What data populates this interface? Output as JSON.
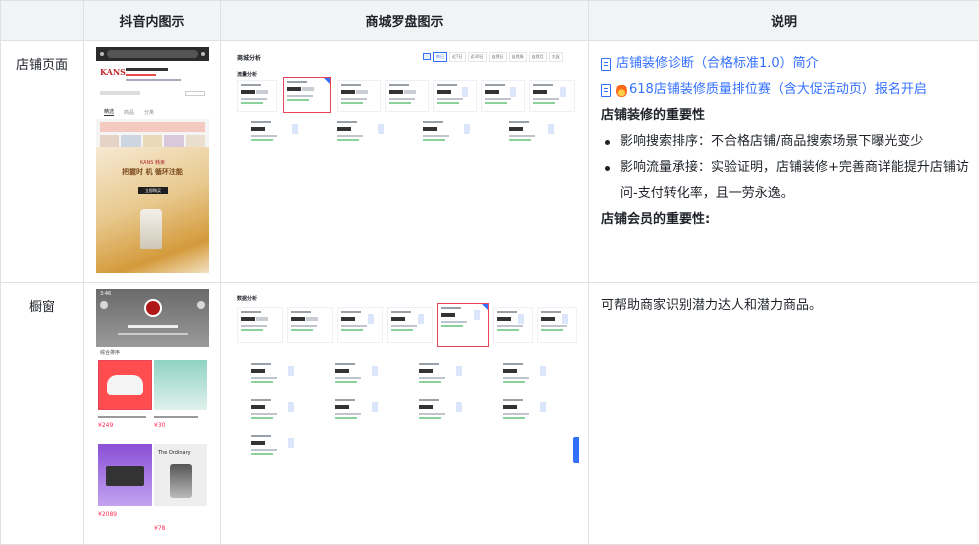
{
  "table": {
    "headers": [
      "",
      "抖音内图示",
      "商城罗盘图示",
      "说明"
    ],
    "rows": [
      {
        "label": "店铺页面",
        "links": [
          {
            "icon": "doc-icon",
            "text": "店铺装修诊断（合格标准1.0）简介"
          },
          {
            "icon": "doc-icon",
            "fire": true,
            "text": "618店铺装修质量排位赛（含大促活动页）报名开启"
          }
        ],
        "heading1": "店铺装修的重要性",
        "bullets": [
          "影响搜索排序：不合格店铺/商品搜索场景下曝光变少",
          "影响流量承接：实验证明，店铺装修+完善商详能提升店铺访问-支付转化率，且一劳永逸。"
        ],
        "heading2": "店铺会员的重要性:"
      },
      {
        "label": "橱窗",
        "note": "可帮助商家识别潜力达人和潜力商品。"
      }
    ]
  },
  "mock_shop_phone": {
    "brand": "KANS",
    "banner_brand": "KANS 韩束",
    "banner_line1": "把握时 机  循环注能",
    "banner_button": "立即购买",
    "tabs": [
      "精选",
      "商品",
      "分类"
    ]
  },
  "mock_shop_dash": {
    "title": "商城分析",
    "section": "流量分析",
    "filters": [
      "昨日",
      "近7日",
      "近30日",
      "自然日",
      "自然周",
      "自然月",
      "大促"
    ]
  },
  "mock_window_phone": {
    "time": "3:46",
    "sort_label": "综合排序",
    "prices": [
      "¥249",
      "¥30",
      "¥2089",
      "¥78"
    ],
    "brand_text": "The Ordinary"
  },
  "mock_window_dash": {
    "section": "数据分析"
  },
  "colors": {
    "link": "#3370ff",
    "header_bg": "#f2f3f5",
    "border": "#dee0e3",
    "highlight": "#e8455b"
  }
}
